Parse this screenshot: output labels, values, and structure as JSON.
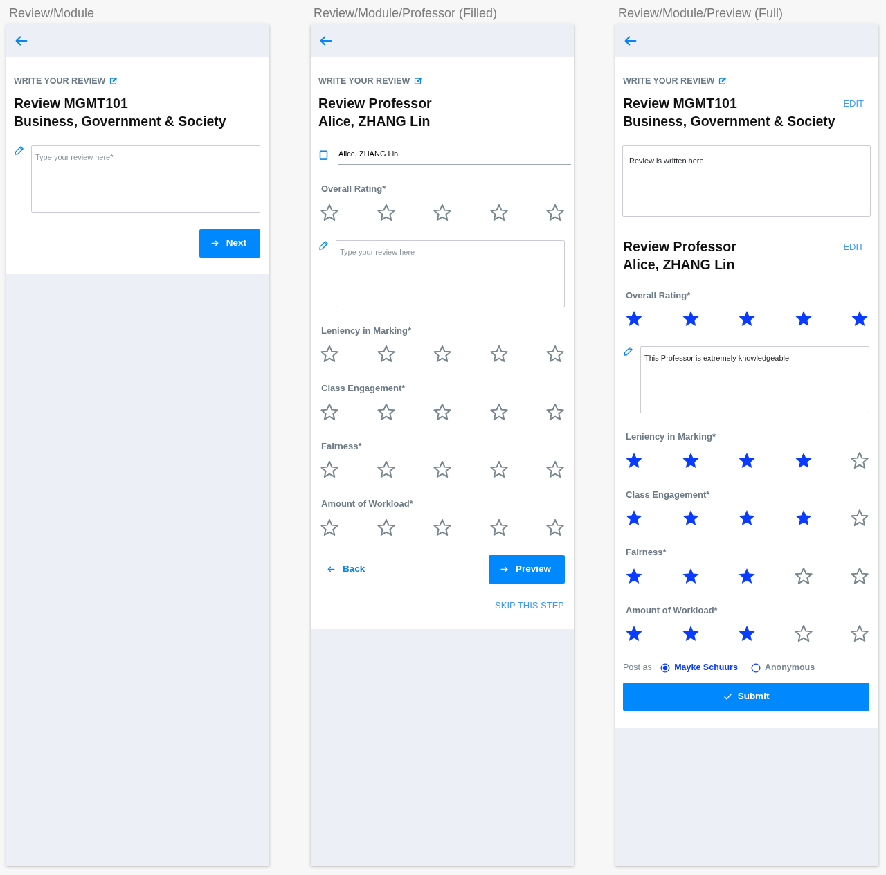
{
  "frames": [
    {
      "title": "Review/Module",
      "blocks": [
        {
          "kind": "kicker",
          "text": "WRITE YOUR REVIEW"
        },
        {
          "kind": "heading",
          "text": "Review MGMT101\nBusiness, Government & Society"
        },
        {
          "kind": "textarea",
          "placeholder": "Type your review here*"
        },
        {
          "kind": "actions",
          "primary": "Next"
        }
      ]
    },
    {
      "title": "Review/Module/Professor (Filled)",
      "blocks": [
        {
          "kind": "kicker",
          "text": "WRITE YOUR REVIEW"
        },
        {
          "kind": "heading",
          "text": "Review Professor\nAlice, ZHANG Lin"
        },
        {
          "kind": "field",
          "value": "Alice, ZHANG Lin"
        },
        {
          "kind": "rating",
          "label": "Overall Rating*",
          "stars": 0
        },
        {
          "kind": "textarea",
          "placeholder": "Type your review here"
        },
        {
          "kind": "rating",
          "label": "Leniency in Marking*",
          "stars": 0
        },
        {
          "kind": "rating",
          "label": "Class Engagement*",
          "stars": 0
        },
        {
          "kind": "rating",
          "label": "Fairness*",
          "stars": 0
        },
        {
          "kind": "rating",
          "label": "Amount of Workload*",
          "stars": 0
        },
        {
          "kind": "actions",
          "back": "Back",
          "primary": "Preview"
        },
        {
          "kind": "link",
          "text": "SKIP THIS STEP"
        }
      ]
    },
    {
      "title": "Review/Module/Preview (Full)",
      "blocks": [
        {
          "kind": "kicker",
          "text": "WRITE YOUR REVIEW"
        },
        {
          "kind": "heading",
          "text": "Review MGMT101\nBusiness, Government & Society",
          "edit": "EDIT"
        },
        {
          "kind": "review_text",
          "value": "Review is written here"
        },
        {
          "kind": "heading",
          "text": "Review Professor\nAlice, ZHANG Lin",
          "edit": "EDIT"
        },
        {
          "kind": "rating",
          "label": "Overall Rating*",
          "stars": 5
        },
        {
          "kind": "textarea",
          "value": "This Professor is extremely knowledgeable!"
        },
        {
          "kind": "rating",
          "label": "Leniency in Marking*",
          "stars": 4
        },
        {
          "kind": "rating",
          "label": "Class Engagement*",
          "stars": 4
        },
        {
          "kind": "rating",
          "label": "Fairness*",
          "stars": 3
        },
        {
          "kind": "rating",
          "label": "Amount of Workload*",
          "stars": 3
        },
        {
          "kind": "post_as",
          "label": "Post as:",
          "options": [
            {
              "label": "Mayke Schuurs",
              "selected": true
            },
            {
              "label": "Anonymous",
              "selected": false
            }
          ]
        },
        {
          "kind": "submit",
          "text": "Submit"
        }
      ]
    }
  ]
}
